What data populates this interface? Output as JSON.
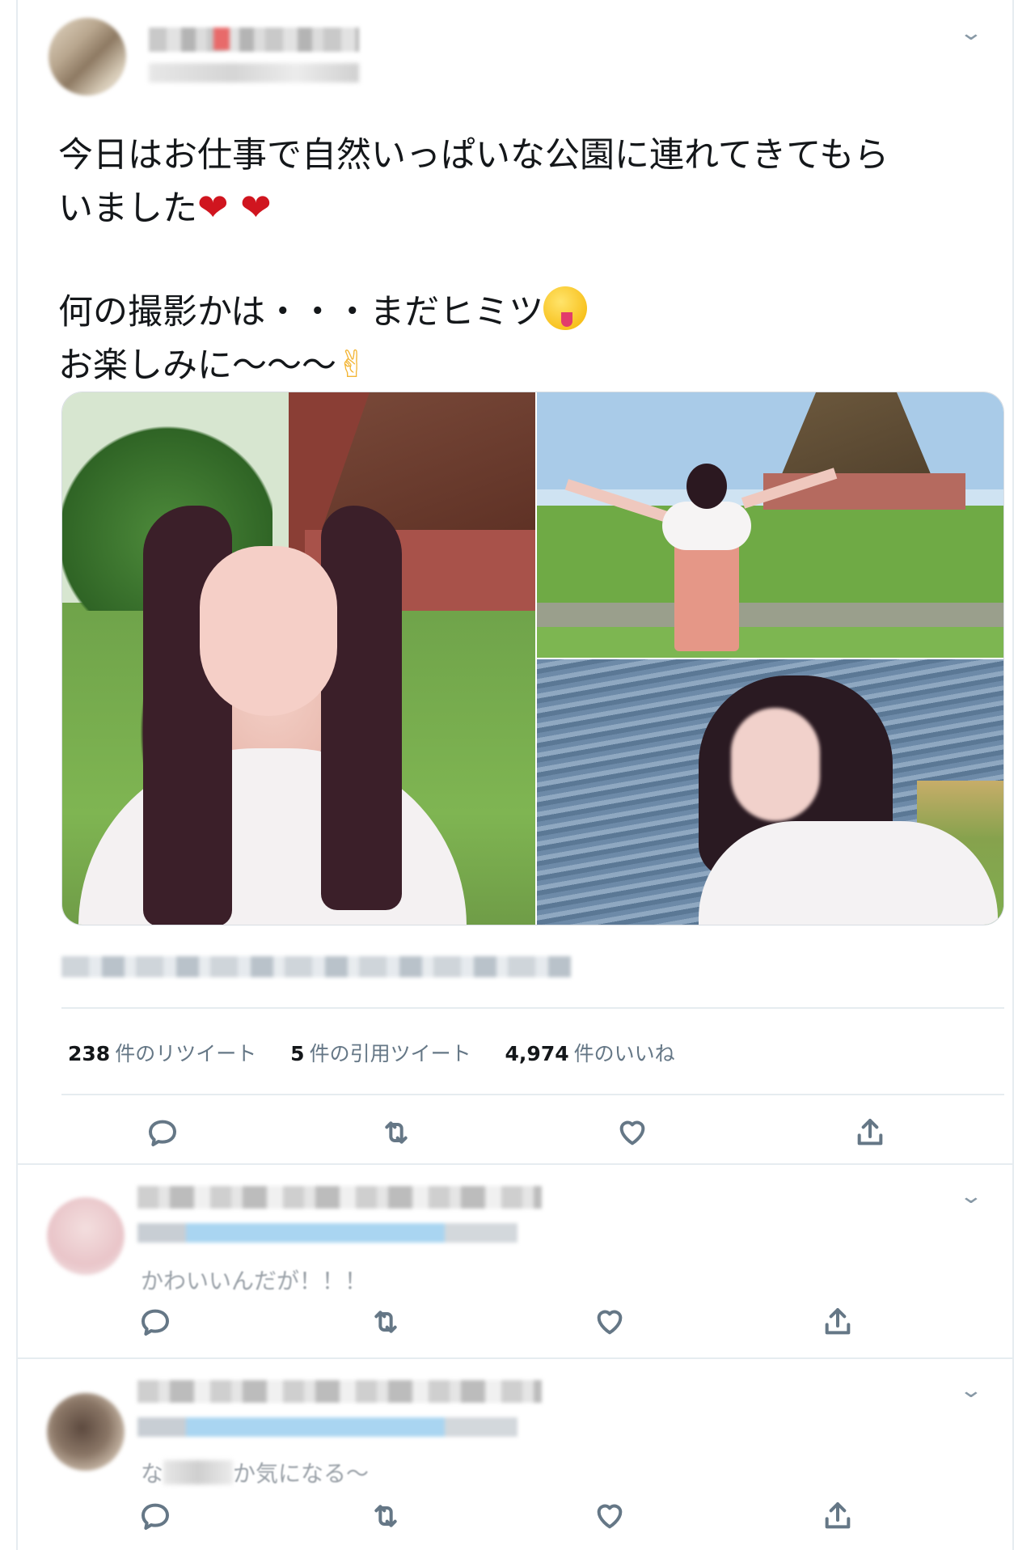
{
  "tweet": {
    "text_line1": "今日はお仕事で自然いっぱいな公園に連れてきてもら",
    "text_line2": "いました",
    "text_line2_hearts": "❤ ❤",
    "text_line4": "何の撮影かは・・・まだヒミツ",
    "text_line5": "お楽しみに〜〜〜",
    "text_line5_emoji": "✌",
    "stats": [
      {
        "count": "238",
        "label": "件のリツイート"
      },
      {
        "count": "5",
        "label": "件の引用ツイート"
      },
      {
        "count": "4,974",
        "label": "件のいいね"
      }
    ]
  },
  "replies": [
    {
      "text_prefix": "",
      "text": "かわいいんだが！！！"
    },
    {
      "text_prefix": "な",
      "text": "か気になる〜"
    }
  ],
  "icons": {
    "reply": "reply-icon",
    "retweet": "retweet-icon",
    "like": "heart-icon",
    "share": "share-icon",
    "menu": "chevron-down-icon"
  },
  "colors": {
    "text": "#14171a",
    "secondary": "#657786",
    "border": "#e6ecf0",
    "heart": "#d0151f"
  }
}
